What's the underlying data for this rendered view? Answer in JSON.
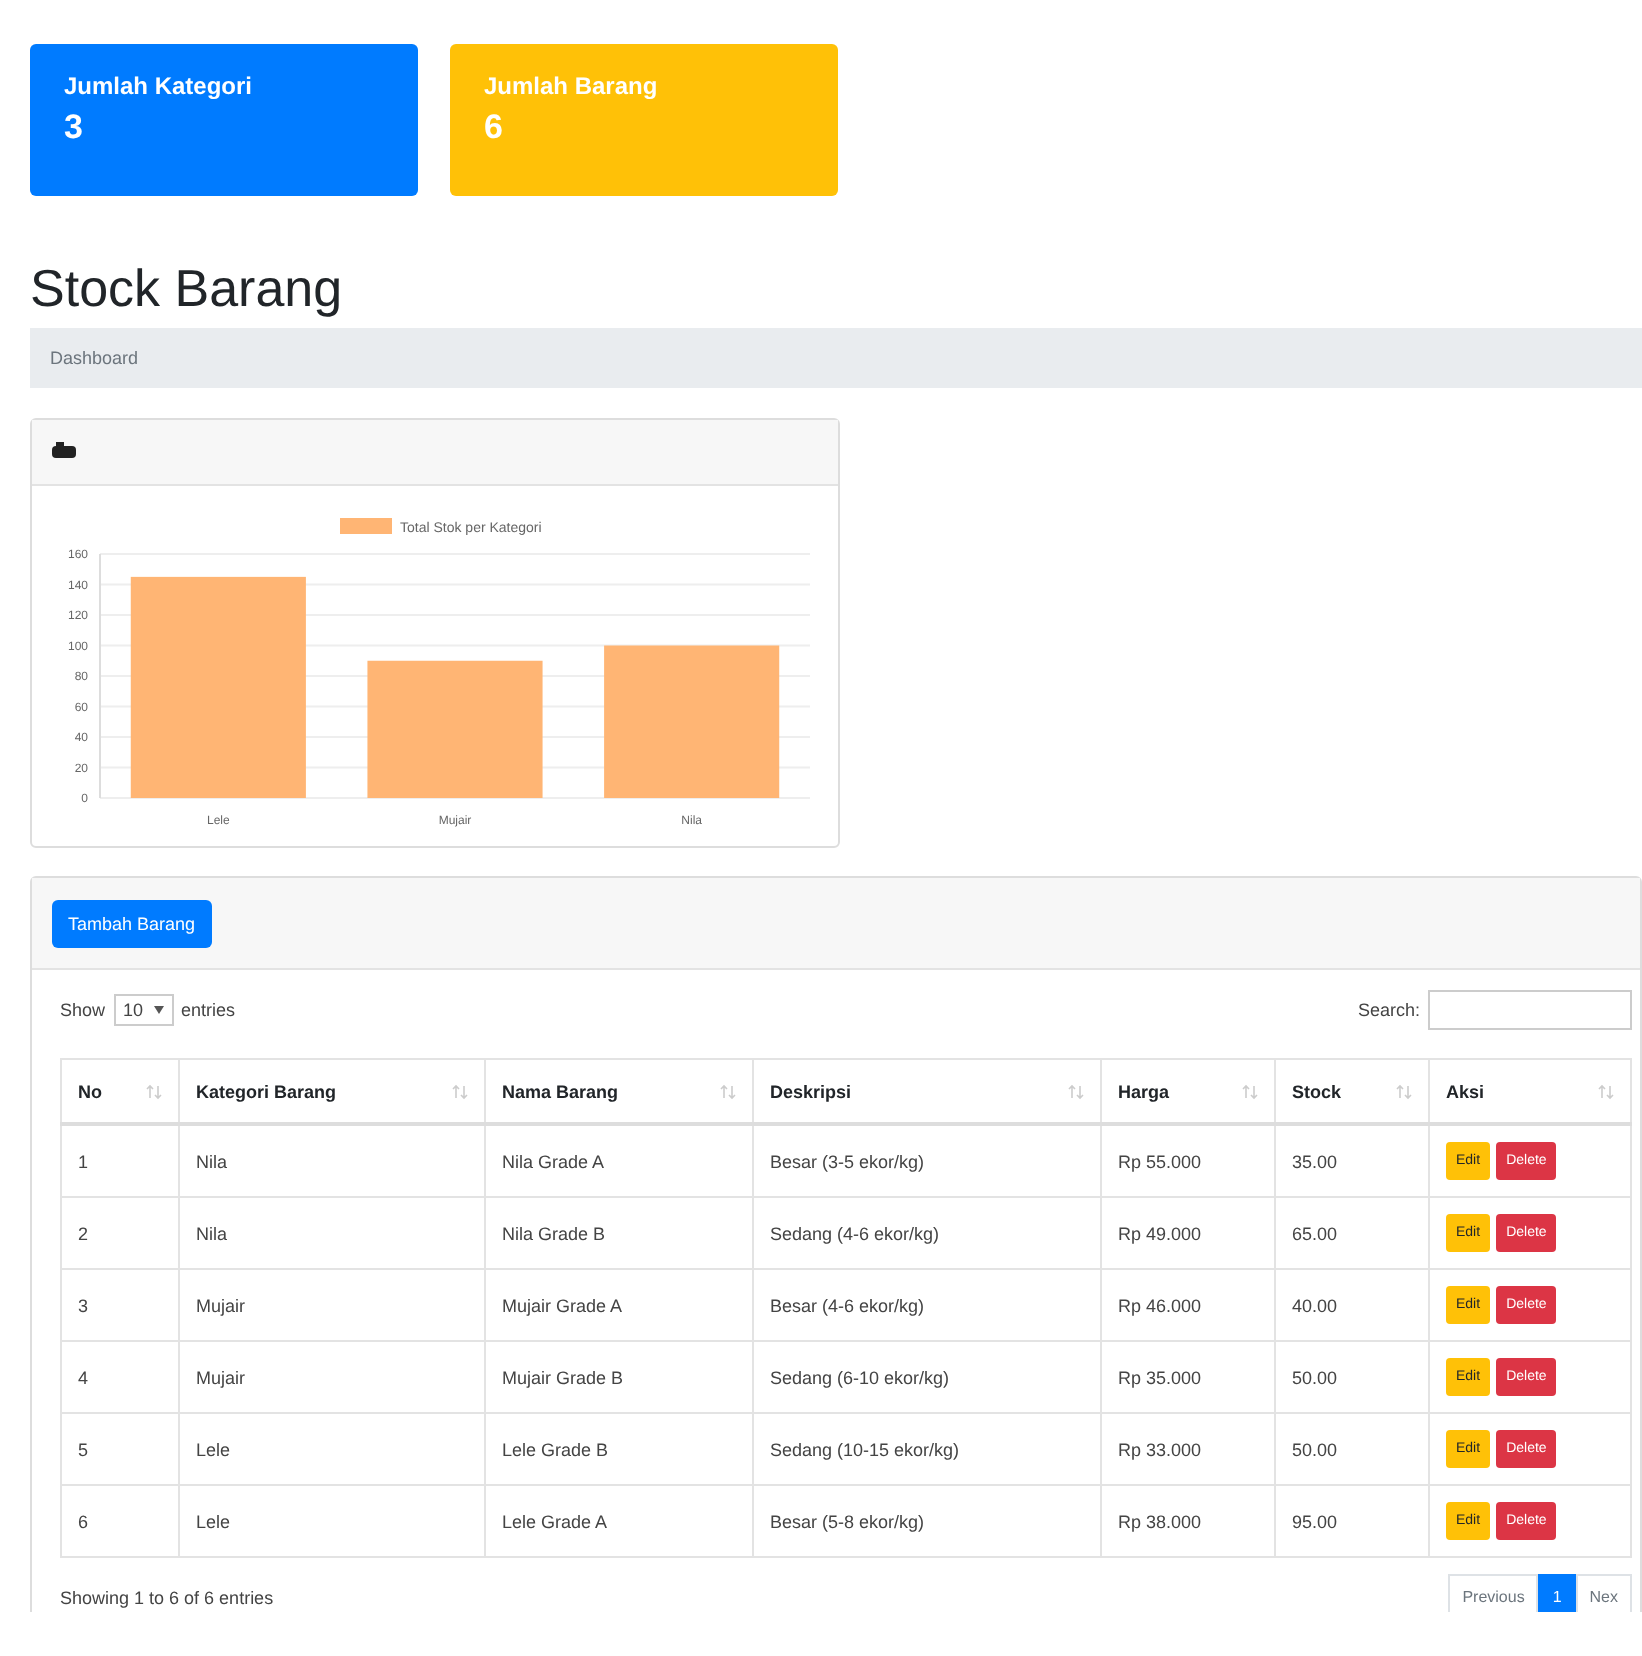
{
  "stat_cards": [
    {
      "label": "Jumlah Kategori",
      "value": "3",
      "color": "#007bff"
    },
    {
      "label": "Jumlah Barang",
      "value": "6",
      "color": "#ffc107"
    }
  ],
  "page_title": "Stock Barang",
  "breadcrumb": [
    "Dashboard"
  ],
  "chart_card": {
    "chart_data": {
      "type": "bar",
      "categories": [
        "Lele",
        "Mujair",
        "Nila"
      ],
      "series": [
        {
          "name": "Total Stok per Kategori",
          "color": "#ffb574",
          "values": [
            145,
            90,
            100
          ]
        }
      ],
      "ylim": [
        0,
        160
      ],
      "yticks": [
        0,
        20,
        40,
        60,
        80,
        100,
        120,
        140,
        160
      ],
      "grid": true
    }
  },
  "table_card": {
    "add_button": "Tambah Barang",
    "length_control": {
      "before": "Show",
      "value": "10",
      "after": "entries"
    },
    "search_label": "Search:",
    "columns": [
      "No",
      "Kategori Barang",
      "Nama Barang",
      "Deskripsi",
      "Harga",
      "Stock",
      "Aksi"
    ],
    "rows": [
      {
        "cells": [
          "1",
          "Nila",
          "Nila Grade A",
          "Besar (3-5 ekor/kg)",
          "Rp 55.000",
          "35.00"
        ],
        "actions": [
          "Edit",
          "Delete"
        ]
      },
      {
        "cells": [
          "2",
          "Nila",
          "Nila Grade B",
          "Sedang (4-6 ekor/kg)",
          "Rp 49.000",
          "65.00"
        ],
        "actions": [
          "Edit",
          "Delete"
        ]
      },
      {
        "cells": [
          "3",
          "Mujair",
          "Mujair Grade A",
          "Besar (4-6 ekor/kg)",
          "Rp 46.000",
          "40.00"
        ],
        "actions": [
          "Edit",
          "Delete"
        ]
      },
      {
        "cells": [
          "4",
          "Mujair",
          "Mujair Grade B",
          "Sedang (6-10 ekor/kg)",
          "Rp 35.000",
          "50.00"
        ],
        "actions": [
          "Edit",
          "Delete"
        ]
      },
      {
        "cells": [
          "5",
          "Lele",
          "Lele Grade B",
          "Sedang (10-15 ekor/kg)",
          "Rp 33.000",
          "50.00"
        ],
        "actions": [
          "Edit",
          "Delete"
        ]
      },
      {
        "cells": [
          "6",
          "Lele",
          "Lele Grade A",
          "Besar (5-8 ekor/kg)",
          "Rp 38.000",
          "95.00"
        ],
        "actions": [
          "Edit",
          "Delete"
        ]
      }
    ],
    "info": "Showing 1 to 6 of 6 entries",
    "pagination": [
      {
        "label": "Previous",
        "selected": false
      },
      {
        "label": "1",
        "selected": true
      },
      {
        "label": "Nex",
        "selected": false
      }
    ]
  }
}
